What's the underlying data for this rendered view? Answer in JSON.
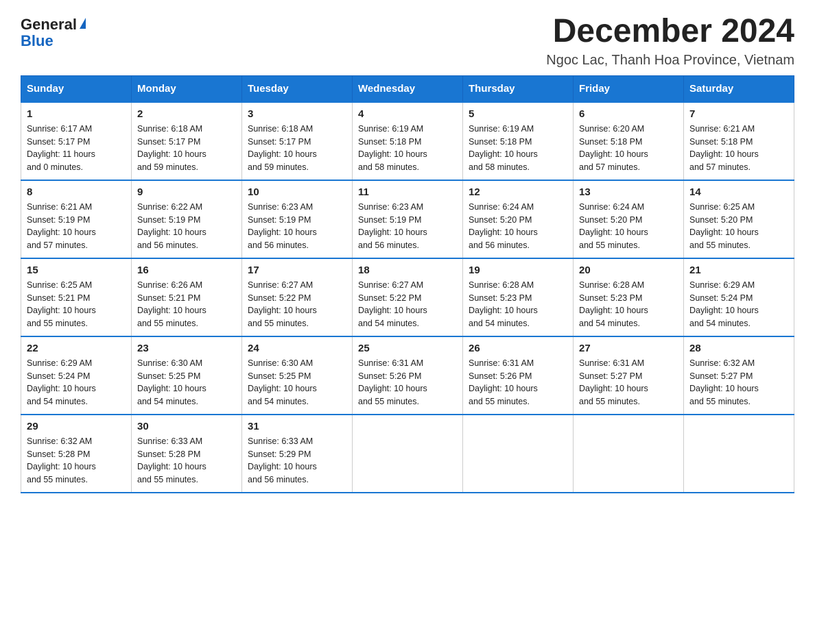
{
  "logo": {
    "general": "General",
    "blue": "Blue"
  },
  "title": "December 2024",
  "location": "Ngoc Lac, Thanh Hoa Province, Vietnam",
  "days_of_week": [
    "Sunday",
    "Monday",
    "Tuesday",
    "Wednesday",
    "Thursday",
    "Friday",
    "Saturday"
  ],
  "weeks": [
    [
      {
        "day": "1",
        "info": "Sunrise: 6:17 AM\nSunset: 5:17 PM\nDaylight: 11 hours\nand 0 minutes."
      },
      {
        "day": "2",
        "info": "Sunrise: 6:18 AM\nSunset: 5:17 PM\nDaylight: 10 hours\nand 59 minutes."
      },
      {
        "day": "3",
        "info": "Sunrise: 6:18 AM\nSunset: 5:17 PM\nDaylight: 10 hours\nand 59 minutes."
      },
      {
        "day": "4",
        "info": "Sunrise: 6:19 AM\nSunset: 5:18 PM\nDaylight: 10 hours\nand 58 minutes."
      },
      {
        "day": "5",
        "info": "Sunrise: 6:19 AM\nSunset: 5:18 PM\nDaylight: 10 hours\nand 58 minutes."
      },
      {
        "day": "6",
        "info": "Sunrise: 6:20 AM\nSunset: 5:18 PM\nDaylight: 10 hours\nand 57 minutes."
      },
      {
        "day": "7",
        "info": "Sunrise: 6:21 AM\nSunset: 5:18 PM\nDaylight: 10 hours\nand 57 minutes."
      }
    ],
    [
      {
        "day": "8",
        "info": "Sunrise: 6:21 AM\nSunset: 5:19 PM\nDaylight: 10 hours\nand 57 minutes."
      },
      {
        "day": "9",
        "info": "Sunrise: 6:22 AM\nSunset: 5:19 PM\nDaylight: 10 hours\nand 56 minutes."
      },
      {
        "day": "10",
        "info": "Sunrise: 6:23 AM\nSunset: 5:19 PM\nDaylight: 10 hours\nand 56 minutes."
      },
      {
        "day": "11",
        "info": "Sunrise: 6:23 AM\nSunset: 5:19 PM\nDaylight: 10 hours\nand 56 minutes."
      },
      {
        "day": "12",
        "info": "Sunrise: 6:24 AM\nSunset: 5:20 PM\nDaylight: 10 hours\nand 56 minutes."
      },
      {
        "day": "13",
        "info": "Sunrise: 6:24 AM\nSunset: 5:20 PM\nDaylight: 10 hours\nand 55 minutes."
      },
      {
        "day": "14",
        "info": "Sunrise: 6:25 AM\nSunset: 5:20 PM\nDaylight: 10 hours\nand 55 minutes."
      }
    ],
    [
      {
        "day": "15",
        "info": "Sunrise: 6:25 AM\nSunset: 5:21 PM\nDaylight: 10 hours\nand 55 minutes."
      },
      {
        "day": "16",
        "info": "Sunrise: 6:26 AM\nSunset: 5:21 PM\nDaylight: 10 hours\nand 55 minutes."
      },
      {
        "day": "17",
        "info": "Sunrise: 6:27 AM\nSunset: 5:22 PM\nDaylight: 10 hours\nand 55 minutes."
      },
      {
        "day": "18",
        "info": "Sunrise: 6:27 AM\nSunset: 5:22 PM\nDaylight: 10 hours\nand 54 minutes."
      },
      {
        "day": "19",
        "info": "Sunrise: 6:28 AM\nSunset: 5:23 PM\nDaylight: 10 hours\nand 54 minutes."
      },
      {
        "day": "20",
        "info": "Sunrise: 6:28 AM\nSunset: 5:23 PM\nDaylight: 10 hours\nand 54 minutes."
      },
      {
        "day": "21",
        "info": "Sunrise: 6:29 AM\nSunset: 5:24 PM\nDaylight: 10 hours\nand 54 minutes."
      }
    ],
    [
      {
        "day": "22",
        "info": "Sunrise: 6:29 AM\nSunset: 5:24 PM\nDaylight: 10 hours\nand 54 minutes."
      },
      {
        "day": "23",
        "info": "Sunrise: 6:30 AM\nSunset: 5:25 PM\nDaylight: 10 hours\nand 54 minutes."
      },
      {
        "day": "24",
        "info": "Sunrise: 6:30 AM\nSunset: 5:25 PM\nDaylight: 10 hours\nand 54 minutes."
      },
      {
        "day": "25",
        "info": "Sunrise: 6:31 AM\nSunset: 5:26 PM\nDaylight: 10 hours\nand 55 minutes."
      },
      {
        "day": "26",
        "info": "Sunrise: 6:31 AM\nSunset: 5:26 PM\nDaylight: 10 hours\nand 55 minutes."
      },
      {
        "day": "27",
        "info": "Sunrise: 6:31 AM\nSunset: 5:27 PM\nDaylight: 10 hours\nand 55 minutes."
      },
      {
        "day": "28",
        "info": "Sunrise: 6:32 AM\nSunset: 5:27 PM\nDaylight: 10 hours\nand 55 minutes."
      }
    ],
    [
      {
        "day": "29",
        "info": "Sunrise: 6:32 AM\nSunset: 5:28 PM\nDaylight: 10 hours\nand 55 minutes."
      },
      {
        "day": "30",
        "info": "Sunrise: 6:33 AM\nSunset: 5:28 PM\nDaylight: 10 hours\nand 55 minutes."
      },
      {
        "day": "31",
        "info": "Sunrise: 6:33 AM\nSunset: 5:29 PM\nDaylight: 10 hours\nand 56 minutes."
      },
      null,
      null,
      null,
      null
    ]
  ]
}
